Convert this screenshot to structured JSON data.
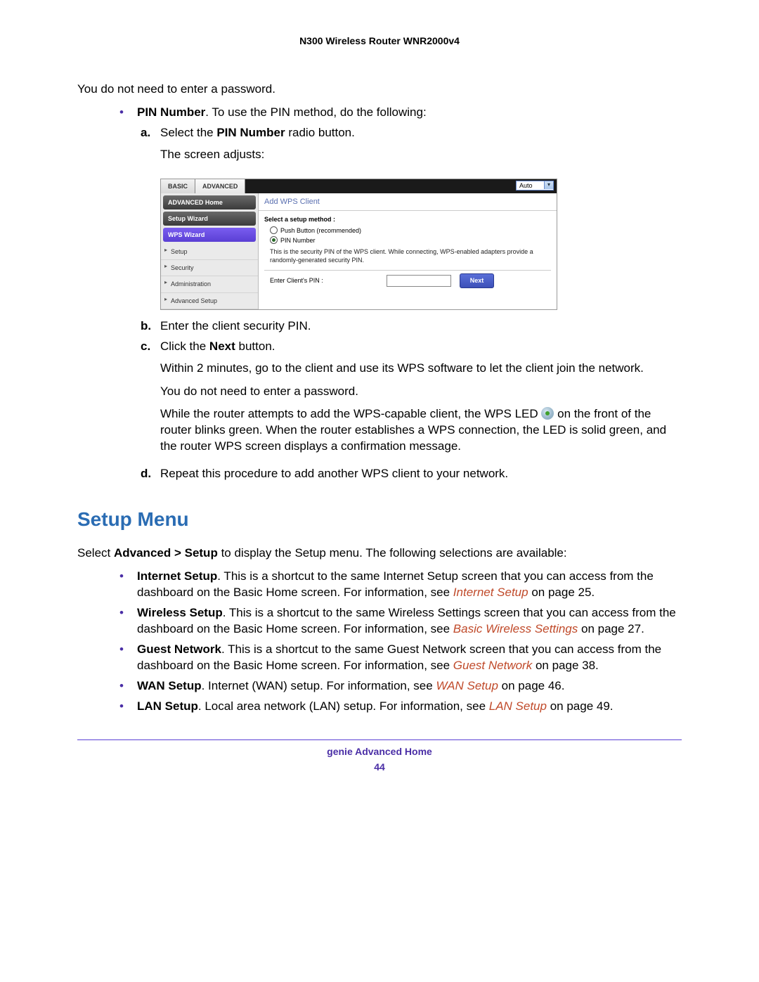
{
  "header": {
    "title": "N300 Wireless Router WNR2000v4"
  },
  "intro": {
    "no_password": "You do not need to enter a password."
  },
  "pin_bullet": {
    "label_bold": "PIN Number",
    "label_tail": ". To use the PIN method, do the following:"
  },
  "steps_a": {
    "marker": "a.",
    "line1_pre": "Select the ",
    "line1_bold": "PIN Number",
    "line1_post": " radio button.",
    "line2": "The screen adjusts:"
  },
  "router_ui": {
    "tabs": {
      "basic": "BASIC",
      "advanced": "ADVANCED"
    },
    "auto": "Auto",
    "nav": {
      "adv_home": "ADVANCED Home",
      "setup_wizard": "Setup Wizard",
      "wps_wizard": "WPS Wizard",
      "setup": "Setup",
      "security": "Security",
      "administration": "Administration",
      "advanced_setup": "Advanced Setup"
    },
    "content": {
      "title": "Add WPS Client",
      "section_label": "Select a setup method :",
      "radio1": "Push Button (recommended)",
      "radio2": "PIN Number",
      "desc": "This is the security PIN of the WPS client. While connecting, WPS-enabled adapters provide a randomly-generated security PIN.",
      "pin_label": "Enter Client's PIN :",
      "next": "Next"
    }
  },
  "steps_b": {
    "marker": "b.",
    "text": "Enter the client security PIN."
  },
  "steps_c": {
    "marker": "c.",
    "line1_pre": "Click the ",
    "line1_bold": "Next",
    "line1_post": " button.",
    "line2": "Within 2 minutes, go to the client and use its WPS software to let the client join the network.",
    "line3": "You do not need to enter a password.",
    "line4_pre": "While the router attempts to add the WPS-capable client, the WPS LED ",
    "line4_post": " on the front of the router blinks green. When the router establishes a WPS connection, the LED is solid green, and the router WPS screen displays a confirmation message."
  },
  "steps_d": {
    "marker": "d.",
    "text": "Repeat this procedure to add another WPS client to your network."
  },
  "section": {
    "heading": "Setup Menu"
  },
  "setup_intro": {
    "pre": "Select ",
    "bold": "Advanced > Setup",
    "post": " to display the Setup menu. The following selections are available:"
  },
  "setup_bullets": {
    "b1": {
      "bold": "Internet Setup",
      "text1": ". This is a shortcut to the same Internet Setup screen that you can access from the dashboard on the Basic Home screen. For information, see ",
      "link": "Internet Setup",
      "tail": " on page 25."
    },
    "b2": {
      "bold": "Wireless Setup",
      "text1": ". This is a shortcut to the same Wireless Settings screen that you can access from the dashboard on the Basic Home screen. For information, see ",
      "link": "Basic Wireless Settings",
      "tail": " on page 27."
    },
    "b3": {
      "bold": "Guest Network",
      "text1": ". This is a shortcut to the same Guest Network screen that you can access from the dashboard on the Basic Home screen. For information, see ",
      "link": "Guest Network",
      "tail": " on page 38."
    },
    "b4": {
      "bold": "WAN Setup",
      "text1": ". Internet (WAN) setup. For information, see ",
      "link": "WAN Setup",
      "tail": " on page 46."
    },
    "b5": {
      "bold": "LAN Setup",
      "text1": ". Local area network (LAN) setup. For information, see ",
      "link": "LAN Setup",
      "tail": " on page 49."
    }
  },
  "footer": {
    "section": "genie Advanced Home",
    "page": "44"
  }
}
